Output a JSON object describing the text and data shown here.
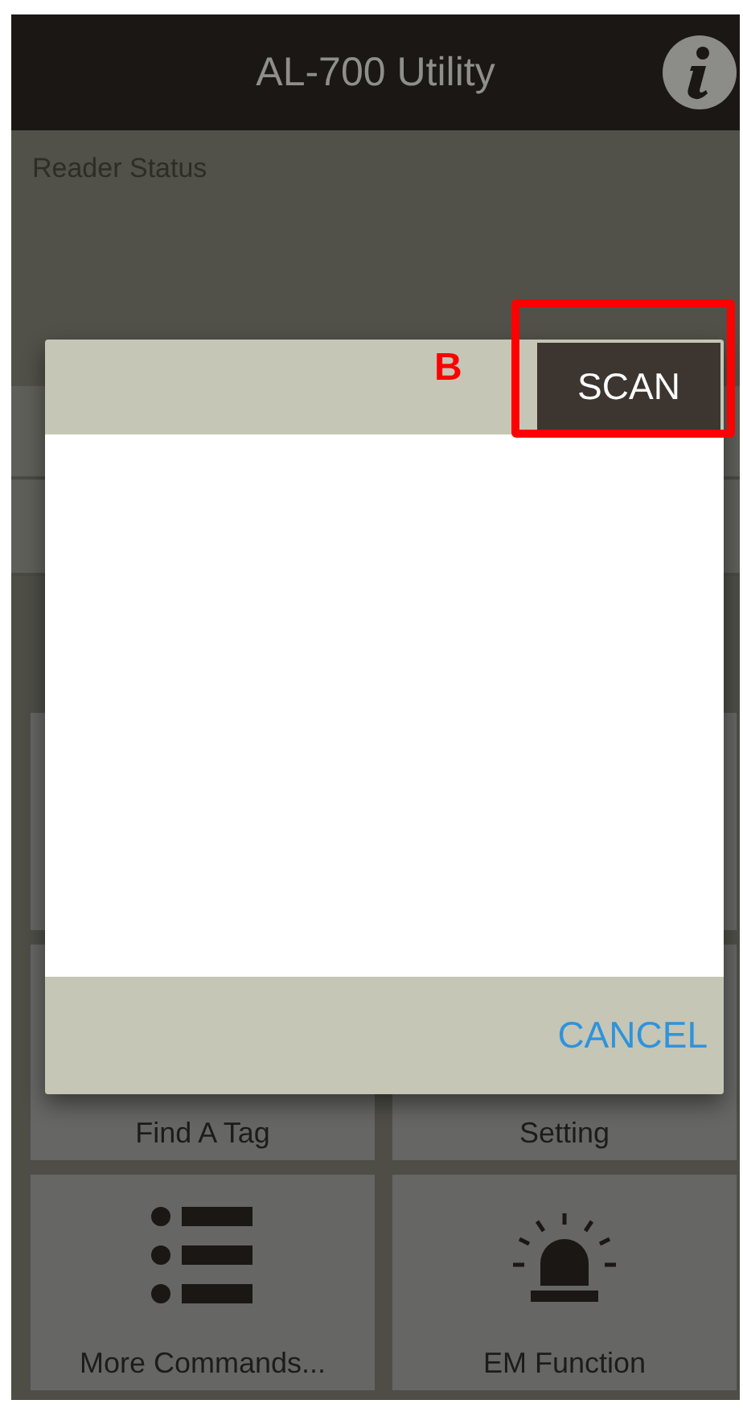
{
  "app_bar": {
    "title": "AL-700 Utility"
  },
  "reader_status": {
    "label": "Reader Status"
  },
  "tiles": [
    {
      "kind": "covered"
    },
    {
      "kind": "covered"
    },
    {
      "kind": "plain",
      "label": "Find A Tag"
    },
    {
      "kind": "plain",
      "label": "Setting"
    },
    {
      "kind": "list",
      "label": "More Commands..."
    },
    {
      "kind": "siren",
      "label": "EM Function"
    }
  ],
  "dialog": {
    "scan_button": "SCAN",
    "cancel_button": "CANCEL"
  },
  "annotation": {
    "label": "B"
  }
}
